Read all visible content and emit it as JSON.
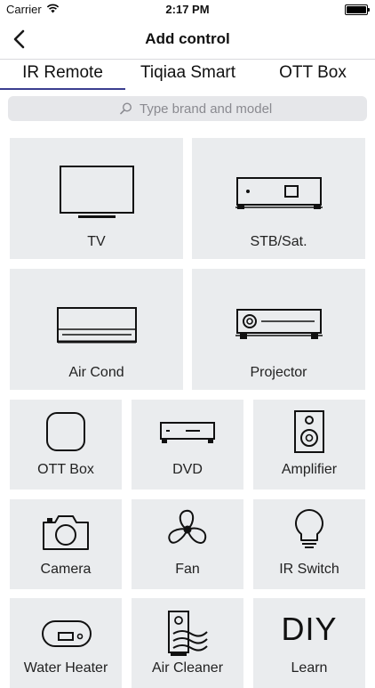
{
  "status_bar": {
    "carrier": "Carrier",
    "time": "2:17 PM"
  },
  "nav": {
    "title": "Add control"
  },
  "tabs": [
    {
      "label": "IR Remote",
      "selected": true
    },
    {
      "label": "Tiqiaa Smart",
      "selected": false
    },
    {
      "label": "OTT Box",
      "selected": false
    }
  ],
  "search": {
    "placeholder": "Type brand and model"
  },
  "devices": [
    {
      "label": "TV",
      "icon": "tv-icon"
    },
    {
      "label": "STB/Sat.",
      "icon": "set-top-box-icon"
    },
    {
      "label": "Air Cond",
      "icon": "air-conditioner-icon"
    },
    {
      "label": "Projector",
      "icon": "projector-icon"
    },
    {
      "label": "OTT Box",
      "icon": "ott-box-icon"
    },
    {
      "label": "DVD",
      "icon": "dvd-player-icon"
    },
    {
      "label": "Amplifier",
      "icon": "speaker-icon"
    },
    {
      "label": "Camera",
      "icon": "camera-icon"
    },
    {
      "label": "Fan",
      "icon": "fan-icon"
    },
    {
      "label": "IR Switch",
      "icon": "light-bulb-icon"
    },
    {
      "label": "Water Heater",
      "icon": "water-heater-icon"
    },
    {
      "label": "Air Cleaner",
      "icon": "air-cleaner-icon"
    },
    {
      "label": "Learn",
      "icon": "diy-icon",
      "icon_text": "DIY"
    }
  ],
  "colors": {
    "tile_bg": "#eaecee",
    "accent": "#3b3e8f",
    "search_bg": "#e6e7ea"
  }
}
